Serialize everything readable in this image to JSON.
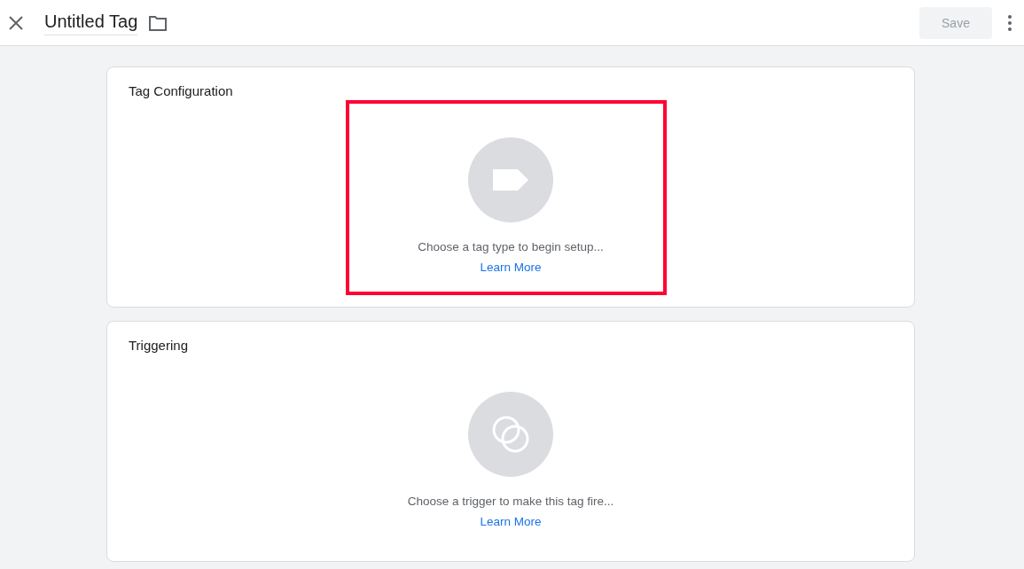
{
  "header": {
    "title": "Untitled Tag",
    "save_button": {
      "label": "Save",
      "disabled": true
    }
  },
  "cards": [
    {
      "kind": "tag",
      "title": "Tag Configuration",
      "hint": "Choose a tag type to begin setup...",
      "link": "Learn More",
      "highlighted": true
    },
    {
      "kind": "trigger",
      "title": "Triggering",
      "hint": "Choose a trigger to make this tag fire...",
      "link": "Learn More",
      "highlighted": false
    }
  ]
}
